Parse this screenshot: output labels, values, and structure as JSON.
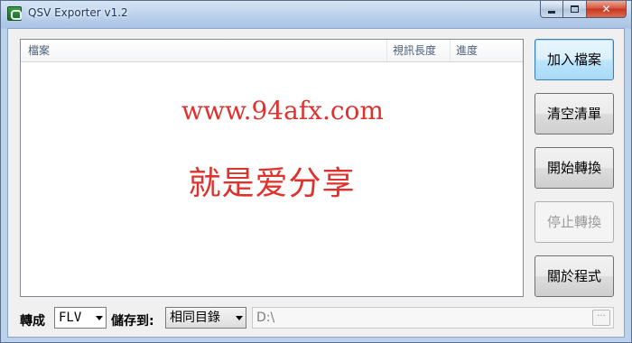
{
  "window": {
    "title": "QSV Exporter v1.2",
    "icon": "qsv-app-icon",
    "controls": {
      "minimize": "minimize-icon",
      "maximize": "maximize-icon",
      "close": "✕"
    }
  },
  "list": {
    "columns": [
      "檔案",
      "視訊長度",
      "進度"
    ],
    "watermark_line1": "www.94afx.com",
    "watermark_line2": "就是爱分享"
  },
  "buttons": {
    "add_files": "加入檔案",
    "clear_list": "清空清單",
    "start_convert": "開始轉換",
    "stop_convert": "停止轉換",
    "about": "關於程式"
  },
  "bottom": {
    "convert_label": "轉成",
    "format_value": "FLV",
    "save_to_label": "儲存到:",
    "save_to_value": "相同目錄",
    "path_value": "D:\\",
    "browse_label": "···"
  },
  "colors": {
    "watermark": "#e0312d",
    "primary_button_border": "#3c7fb1",
    "close_button": "#c7371e"
  }
}
